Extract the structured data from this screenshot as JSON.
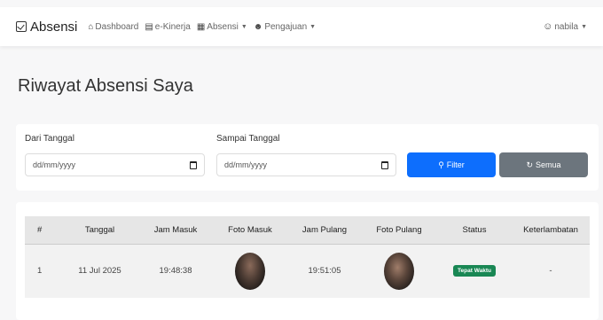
{
  "navbar": {
    "brand": "Absensi",
    "items": [
      {
        "label": "Dashboard",
        "icon": "home-icon",
        "dropdown": false
      },
      {
        "label": "e-Kinerja",
        "icon": "briefcase-icon",
        "dropdown": false
      },
      {
        "label": "Absensi",
        "icon": "calendar-icon",
        "dropdown": true
      },
      {
        "label": "Pengajuan",
        "icon": "users-icon",
        "dropdown": true
      }
    ],
    "user": "nabila"
  },
  "page": {
    "title": "Riwayat Absensi Saya"
  },
  "filter": {
    "from_label": "Dari Tanggal",
    "from_placeholder": "dd/mm/yyyy",
    "to_label": "Sampai Tanggal",
    "to_placeholder": "dd/mm/yyyy",
    "filter_button": "Filter",
    "all_button": "Semua"
  },
  "table": {
    "headers": [
      "#",
      "Tanggal",
      "Jam Masuk",
      "Foto Masuk",
      "Jam Pulang",
      "Foto Pulang",
      "Status",
      "Keterlambatan"
    ],
    "rows": [
      {
        "no": "1",
        "tanggal": "11 Jul 2025",
        "jam_masuk": "19:48:38",
        "jam_pulang": "19:51:05",
        "status": "Tepat Waktu",
        "keterlambatan": "-"
      }
    ]
  },
  "colors": {
    "primary": "#0d6efd",
    "secondary": "#6c757d",
    "success": "#198754"
  }
}
